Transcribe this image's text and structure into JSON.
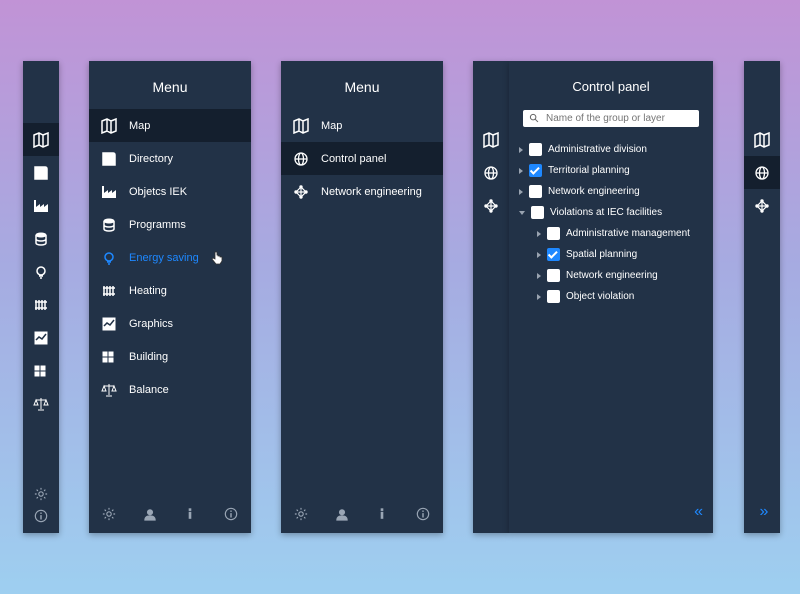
{
  "menu": {
    "title": "Menu",
    "items": [
      {
        "id": "map",
        "label": "Map"
      },
      {
        "id": "directory",
        "label": "Directory"
      },
      {
        "id": "objects-iek",
        "label": "Objetcs IEK"
      },
      {
        "id": "programms",
        "label": "Programms"
      },
      {
        "id": "energy-saving",
        "label": "Energy saving"
      },
      {
        "id": "heating",
        "label": "Heating"
      },
      {
        "id": "graphics",
        "label": "Graphics"
      },
      {
        "id": "building",
        "label": "Building"
      },
      {
        "id": "balance",
        "label": "Balance"
      }
    ]
  },
  "short_menu": {
    "items": [
      {
        "id": "map",
        "label": "Map"
      },
      {
        "id": "control-panel",
        "label": "Control panel"
      },
      {
        "id": "network-engineering",
        "label": "Network engineering"
      }
    ]
  },
  "control_panel": {
    "title": "Control panel",
    "search_placeholder": "Name of the group or layer",
    "tree": [
      {
        "id": "admin-division",
        "label": "Administrative division",
        "checked": false,
        "expanded": false
      },
      {
        "id": "territorial-planning",
        "label": "Territorial planning",
        "checked": true,
        "expanded": false
      },
      {
        "id": "network-eng",
        "label": "Network engineering",
        "checked": false,
        "expanded": false
      },
      {
        "id": "violations",
        "label": "Violations at IEC facilities",
        "checked": false,
        "expanded": true,
        "children": [
          {
            "id": "admin-mgmt",
            "label": "Administrative management",
            "checked": false
          },
          {
            "id": "spatial-planning",
            "label": "Spatial planning",
            "checked": true
          },
          {
            "id": "network-eng-child",
            "label": "Network engineering",
            "checked": false
          },
          {
            "id": "object-violation",
            "label": "Object violation",
            "checked": false
          }
        ]
      }
    ]
  }
}
